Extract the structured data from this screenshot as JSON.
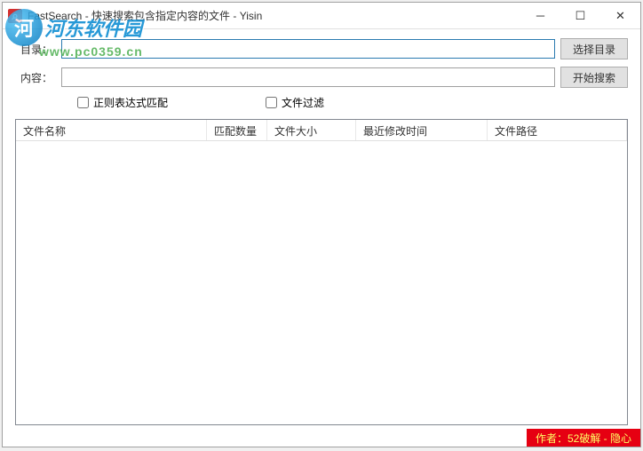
{
  "window": {
    "title": "FastSearch - 快速搜索包含指定内容的文件 - Yisin"
  },
  "form": {
    "dir_label": "目录：",
    "dir_value": "",
    "content_label": "内容：",
    "content_value": "",
    "select_dir_btn": "选择目录",
    "start_search_btn": "开始搜索"
  },
  "options": {
    "regex_label": "正则表达式匹配",
    "filter_label": "文件过滤"
  },
  "table": {
    "columns": [
      "文件名称",
      "匹配数量",
      "文件大小",
      "最近修改时间",
      "文件路径"
    ],
    "rows": []
  },
  "status": {
    "author": "作者：52破解 - 隐心"
  },
  "watermark": {
    "site_name": "河东软件园",
    "url": "www.pc0359.cn"
  }
}
